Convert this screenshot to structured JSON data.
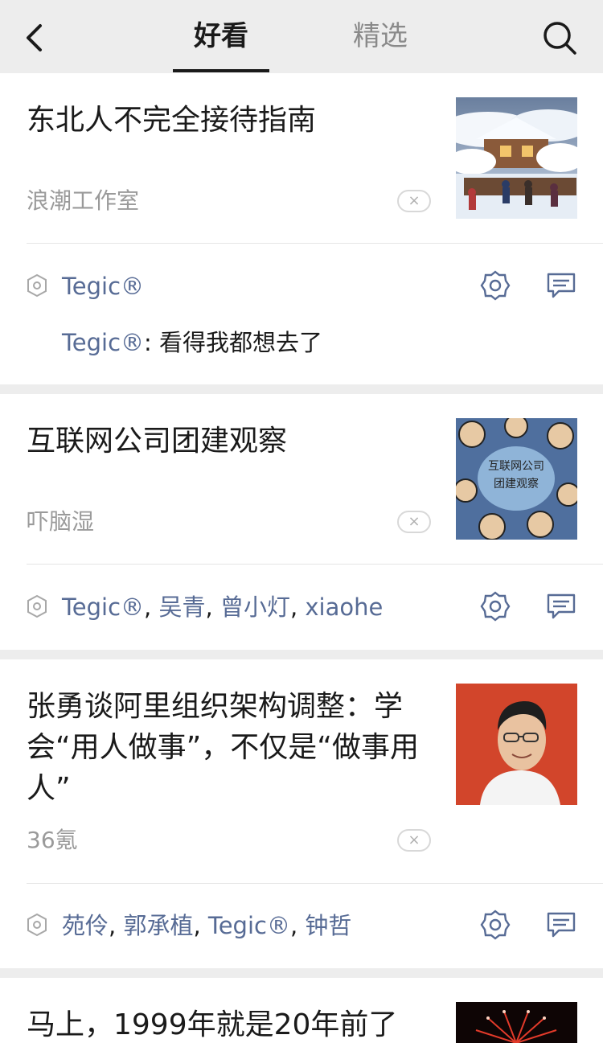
{
  "header": {
    "tabs": [
      {
        "label": "好看",
        "active": true
      },
      {
        "label": "精选",
        "active": false
      }
    ]
  },
  "articles": [
    {
      "title": "东北人不完全接待指南",
      "source": "浪潮工作室",
      "thumbnail": "snow-village-image",
      "likers": [
        "Tegic®"
      ],
      "comment": {
        "author": "Tegic®",
        "separator": ": ",
        "text": "看得我都想去了"
      }
    },
    {
      "title": "互联网公司团建观察",
      "source": "吓脑湿",
      "thumbnail": "team-building-cartoon-image",
      "thumb_text_1": "互联网公司",
      "thumb_text_2": "团建观察",
      "likers": [
        "Tegic®",
        "吴青",
        "曾小灯",
        "xiaohe"
      ]
    },
    {
      "title": "张勇谈阿里组织架构调整：学会“用人做事”，不仅是“做事用人”",
      "source": "36氪",
      "thumbnail": "portrait-photo-image",
      "likers": [
        "苑伶",
        "郭承植",
        "Tegic®",
        "钟哲"
      ]
    },
    {
      "title": "马上，1999年就是20年前了",
      "thumbnail": "fireworks-image"
    }
  ],
  "ui": {
    "dismiss_glyph": "×",
    "liker_separator": ", "
  },
  "colors": {
    "background": "#ededed",
    "link_blue": "#576b95",
    "secondary_text": "#9a9a9a"
  }
}
